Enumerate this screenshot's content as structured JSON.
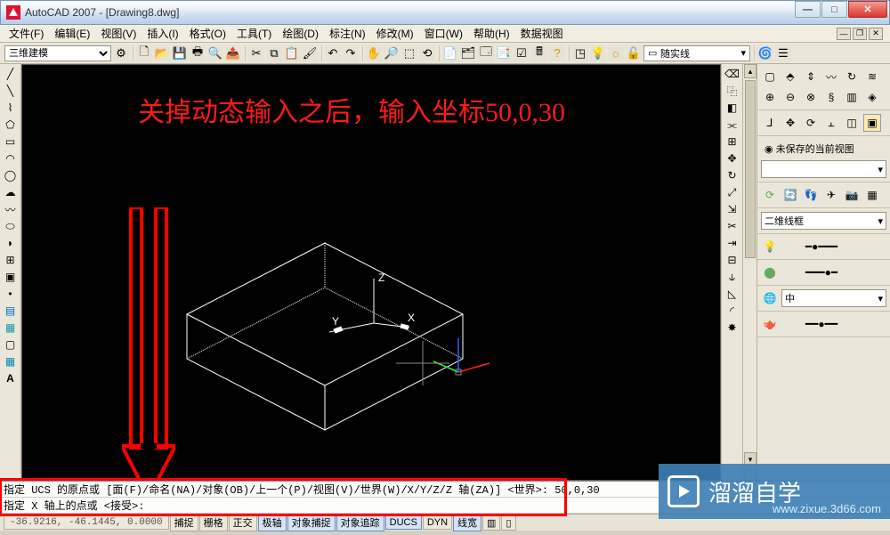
{
  "app_title": "AutoCAD 2007 - [Drawing8.dwg]",
  "menus": [
    "文件(F)",
    "编辑(E)",
    "视图(V)",
    "插入(I)",
    "格式(O)",
    "工具(T)",
    "绘图(D)",
    "标注(N)",
    "修改(M)",
    "窗口(W)",
    "帮助(H)",
    "数据视图"
  ],
  "workspace": "三维建模",
  "linetype": "随实线",
  "overlay_text": "关掉动态输入之后，输入坐标50,0,30",
  "axes": {
    "x": "X",
    "y": "Y",
    "z": "Z"
  },
  "view_panel": {
    "current_view": "未保存的当前视图",
    "visual_style": "二维线框",
    "lang": "中"
  },
  "command": {
    "line1": "指定 UCS 的原点或 [面(F)/命名(NA)/对象(OB)/上一个(P)/视图(V)/世界(W)/X/Y/Z/Z 轴(ZA)] <世界>: 50,0,30",
    "line2": "指定 X 轴上的点或 <接受>:"
  },
  "status": {
    "coords": "-36.9216, -46.1445, 0.0000",
    "toggles": [
      "捕捉",
      "栅格",
      "正交",
      "极轴",
      "对象捕捉",
      "对象追踪",
      "DUCS",
      "DYN",
      "线宽"
    ]
  },
  "watermark": {
    "name": "溜溜自学",
    "site": "www.zixue.3d66.com"
  }
}
